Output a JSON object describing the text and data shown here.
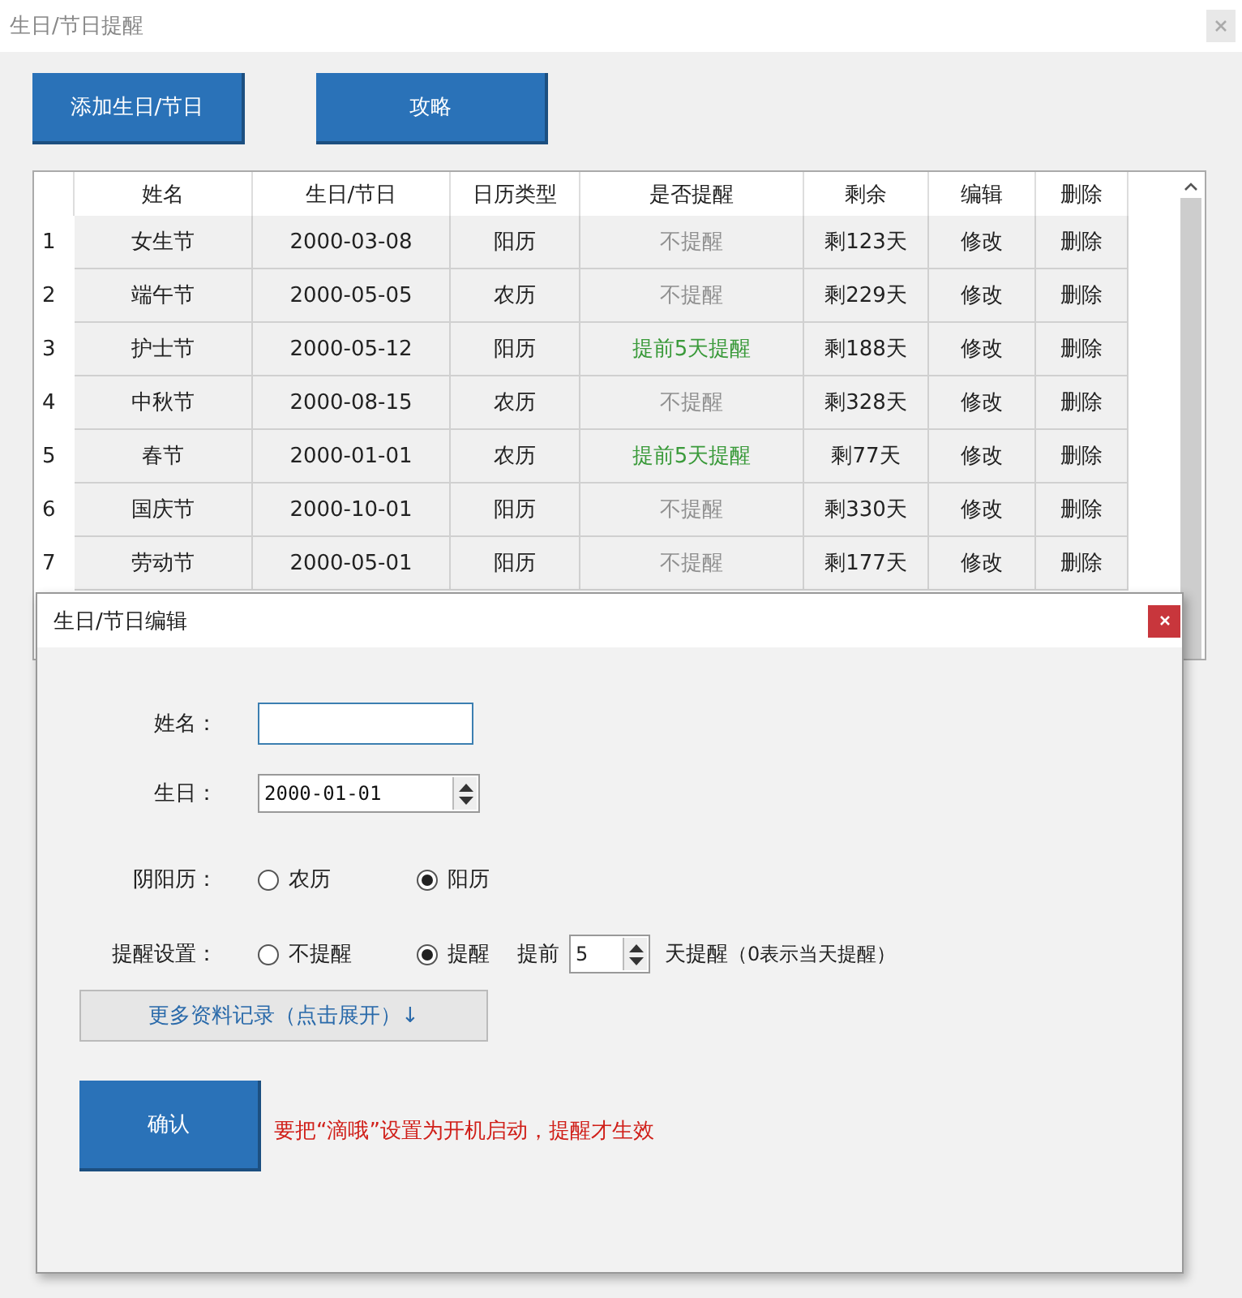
{
  "window": {
    "title": "生日/节日提醒"
  },
  "toolbar": {
    "buttons": [
      "添加生日/节日",
      "攻略"
    ]
  },
  "table": {
    "columns": [
      "姓名",
      "生日/节日",
      "日历类型",
      "是否提醒",
      "剩余",
      "编辑",
      "删除"
    ],
    "rows": [
      {
        "index": "1",
        "name": "女生节",
        "date": "2000-03-08",
        "calendar": "阳历",
        "reminder": {
          "text": "不提醒",
          "on": false
        },
        "remaining": "剩123天",
        "edit": "修改",
        "delete": "删除"
      },
      {
        "index": "2",
        "name": "端午节",
        "date": "2000-05-05",
        "calendar": "农历",
        "reminder": {
          "text": "不提醒",
          "on": false
        },
        "remaining": "剩229天",
        "edit": "修改",
        "delete": "删除"
      },
      {
        "index": "3",
        "name": "护士节",
        "date": "2000-05-12",
        "calendar": "阳历",
        "reminder": {
          "text": "提前5天提醒",
          "on": true
        },
        "remaining": "剩188天",
        "edit": "修改",
        "delete": "删除"
      },
      {
        "index": "4",
        "name": "中秋节",
        "date": "2000-08-15",
        "calendar": "农历",
        "reminder": {
          "text": "不提醒",
          "on": false
        },
        "remaining": "剩328天",
        "edit": "修改",
        "delete": "删除"
      },
      {
        "index": "5",
        "name": "春节",
        "date": "2000-01-01",
        "calendar": "农历",
        "reminder": {
          "text": "提前5天提醒",
          "on": true
        },
        "remaining": "剩77天",
        "edit": "修改",
        "delete": "删除"
      },
      {
        "index": "6",
        "name": "国庆节",
        "date": "2000-10-01",
        "calendar": "阳历",
        "reminder": {
          "text": "不提醒",
          "on": false
        },
        "remaining": "剩330天",
        "edit": "修改",
        "delete": "删除"
      },
      {
        "index": "7",
        "name": "劳动节",
        "date": "2000-05-01",
        "calendar": "阳历",
        "reminder": {
          "text": "不提醒",
          "on": false
        },
        "remaining": "剩177天",
        "edit": "修改",
        "delete": "删除"
      }
    ]
  },
  "dialog": {
    "title": "生日/节日编辑",
    "name_field": {
      "label": "姓名："
    },
    "birthday_field": {
      "label": "生日：",
      "value": "2000-01-01"
    },
    "calendar": {
      "label": "阴阳历：",
      "options": [
        {
          "label": "农历",
          "selected": false
        },
        {
          "label": "阳历",
          "selected": true
        }
      ]
    },
    "reminder": {
      "label": "提醒设置：",
      "options": [
        {
          "label": "不提醒",
          "selected": false
        },
        {
          "label": "提醒",
          "selected": true
        }
      ],
      "advance_label": "提前",
      "advance_value": "5",
      "suffix": "天提醒",
      "note": "（0表示当天提醒）"
    },
    "expand_button": "更多资料记录（点击展开）↓",
    "confirm_button": "确认",
    "warning": "要把“滴哦”设置为开机启动，提醒才生效"
  }
}
